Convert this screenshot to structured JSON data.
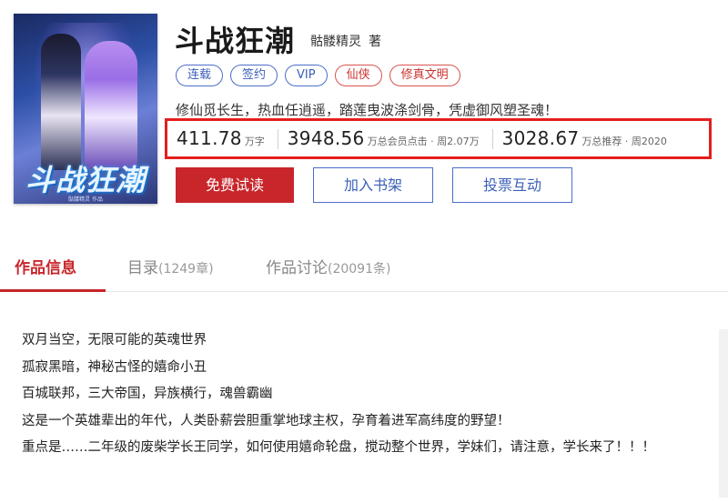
{
  "book": {
    "title": "斗战狂潮",
    "author": "骷髅精灵",
    "author_suffix": "著",
    "cover": {
      "title_art": "斗战狂潮",
      "author_line": "骷髅精灵 作品"
    },
    "tags": [
      {
        "label": "连载",
        "color": "blue"
      },
      {
        "label": "签约",
        "color": "blue"
      },
      {
        "label": "VIP",
        "color": "blue"
      },
      {
        "label": "仙侠",
        "color": "red"
      },
      {
        "label": "修真文明",
        "color": "red"
      }
    ],
    "intro": "修仙觅长生，热血任逍遥，踏莲曳波涤剑骨，凭虚御风塑圣魂！"
  },
  "stats": [
    {
      "value": "411.78",
      "unit": "万字"
    },
    {
      "value": "3948.56",
      "unit": "万总会员点击 · 周2.07万"
    },
    {
      "value": "3028.67",
      "unit": "万总推荐 · 周2020"
    }
  ],
  "buttons": {
    "read": "免费试读",
    "shelf": "加入书架",
    "vote": "投票互动"
  },
  "tabs": [
    {
      "label": "作品信息",
      "count": ""
    },
    {
      "label": "目录",
      "count": "(1249章)"
    },
    {
      "label": "作品讨论",
      "count": "(20091条)"
    }
  ],
  "description": [
    "双月当空，无限可能的英魂世界",
    "孤寂黑暗，神秘古怪的嬉命小丑",
    "百城联邦，三大帝国，异族横行，魂兽霸幽",
    "这是一个英雄辈出的年代，人类卧薪尝胆重掌地球主权，孕育着进军高纬度的野望！",
    "重点是……二年级的废柴学长王同学，如何使用嬉命轮盘，搅动整个世界，学妹们，请注意，学长来了！！！"
  ],
  "colors": {
    "accent_red": "#c8262b",
    "highlight_box": "#e41e1e",
    "tag_blue": "#3b5fb8"
  }
}
